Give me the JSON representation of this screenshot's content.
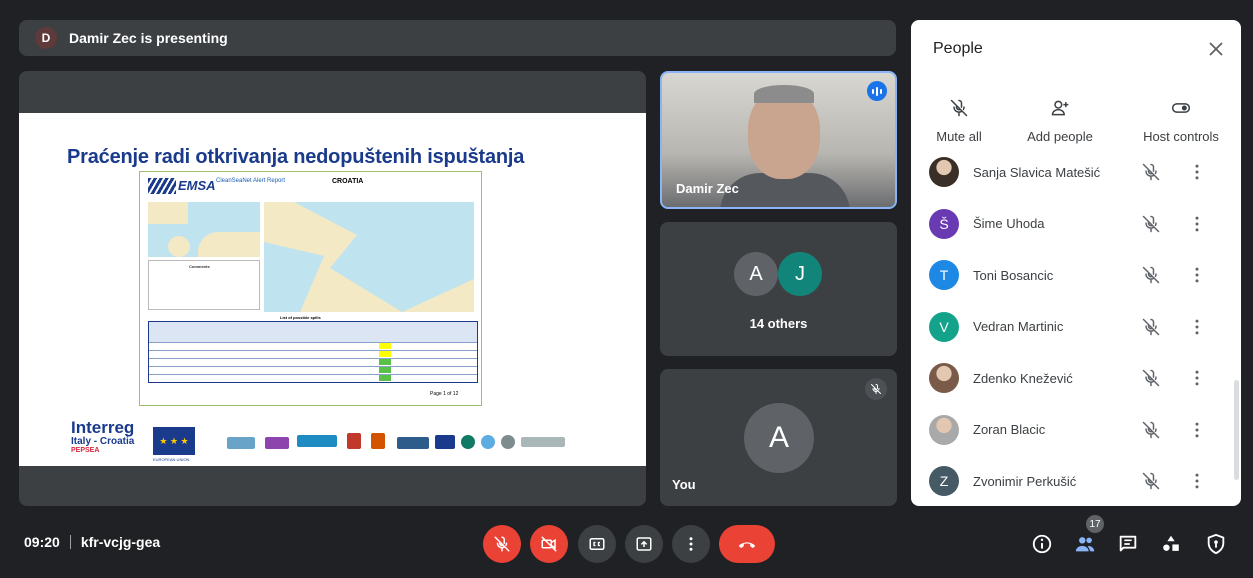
{
  "presenting": {
    "avatar_letter": "D",
    "text": "Damir Zec is presenting"
  },
  "slide": {
    "title": "Praćenje radi otkrivanja nedopuštenih ispuštanja",
    "report_title": "CleanSeaNet Alert Report",
    "report_country": "CROATIA",
    "report_brand": "EMSA",
    "comments_label": "Comments",
    "table_title": "List of possible spills",
    "page": "Page 1 of 12",
    "logo_interreg": "Interreg",
    "logo_program": "Italy - Croatia",
    "logo_project": "PEPSEA",
    "eu_label": "EUROPEAN UNION"
  },
  "tiles": {
    "speaker_name": "Damir Zec",
    "others": {
      "avatars": [
        {
          "letter": "A",
          "color": "#5f6368"
        },
        {
          "letter": "J",
          "color": "#12857a"
        }
      ],
      "label": "14 others"
    },
    "self": {
      "letter": "A",
      "label": "You"
    }
  },
  "panel": {
    "title": "People",
    "actions": [
      {
        "label": "Mute all",
        "icon": "mic-off-icon"
      },
      {
        "label": "Add people",
        "icon": "add-person-icon"
      },
      {
        "label": "Host controls",
        "icon": "toggle-icon"
      }
    ],
    "people": [
      {
        "name": "Sanja Slavica Matešić",
        "letter": "",
        "color": "#3a2f28",
        "photo": true
      },
      {
        "name": "Šime Uhoda",
        "letter": "Š",
        "color": "#6a3ab2",
        "photo": false
      },
      {
        "name": "Toni Bosancic",
        "letter": "T",
        "color": "#1e88e5",
        "photo": false
      },
      {
        "name": "Vedran Martinic",
        "letter": "V",
        "color": "#12a38a",
        "photo": false
      },
      {
        "name": "Zdenko Knežević",
        "letter": "",
        "color": "#7a5a48",
        "photo": true
      },
      {
        "name": "Zoran Blacic",
        "letter": "",
        "color": "#a9a9a9",
        "photo": true
      },
      {
        "name": "Zvonimir Perkušić",
        "letter": "Z",
        "color": "#455a64",
        "photo": false
      }
    ]
  },
  "bottom": {
    "time": "09:20",
    "meeting_code": "kfr-vcjg-gea",
    "participants_count": "17"
  }
}
